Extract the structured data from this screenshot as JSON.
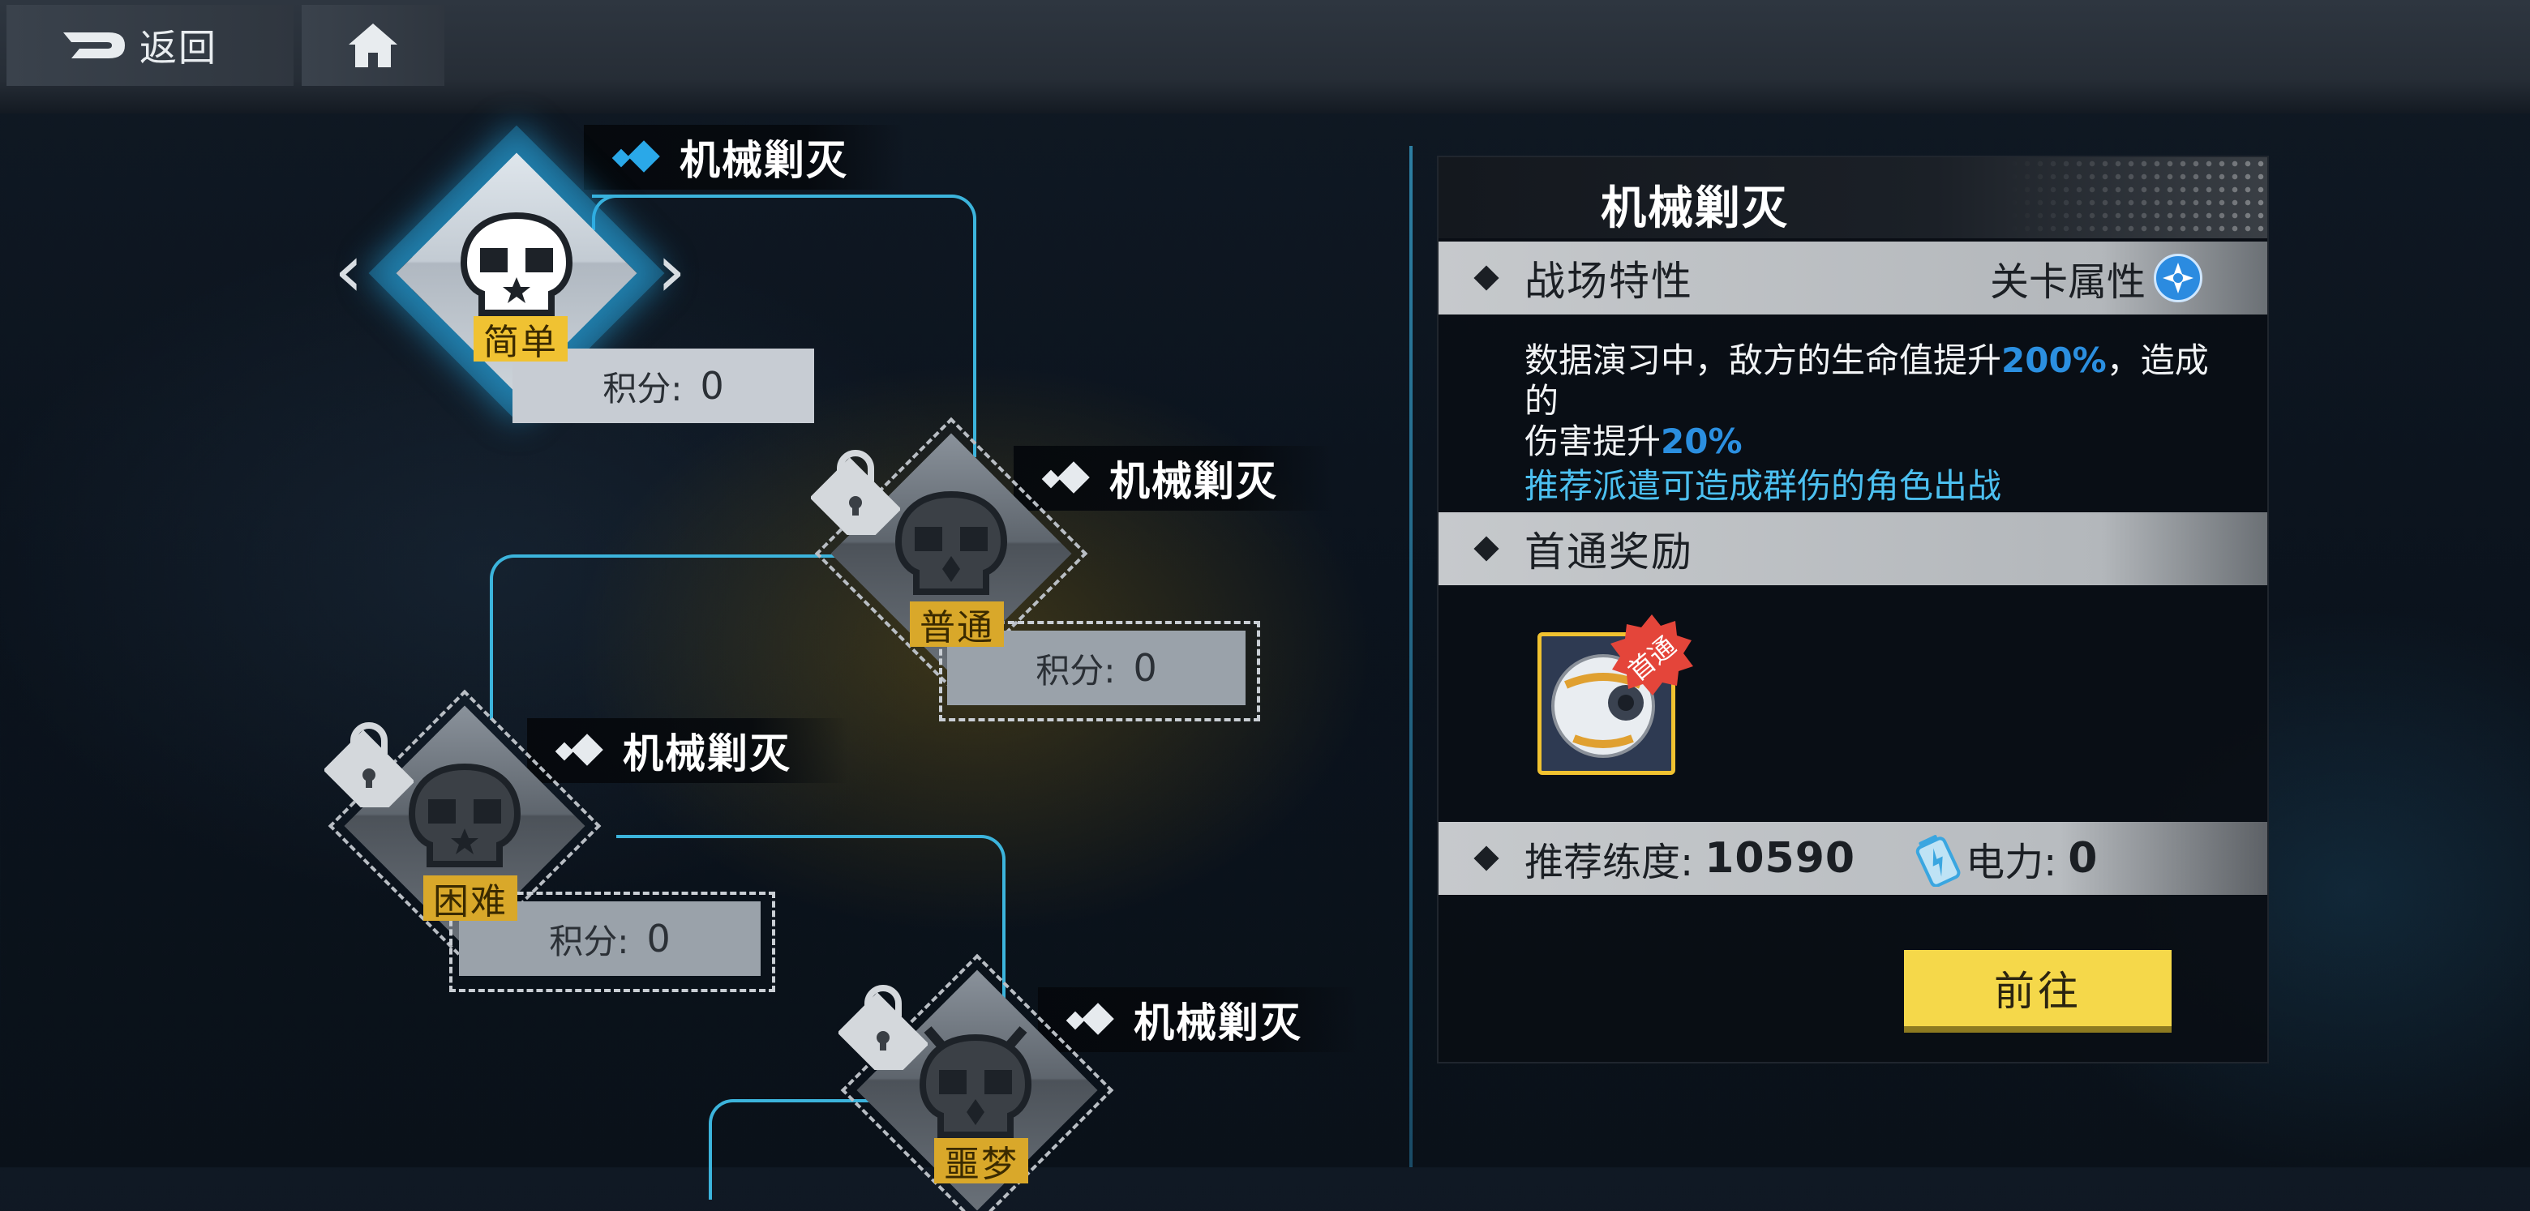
{
  "topbar": {
    "back_label": "返回"
  },
  "stages": [
    {
      "title": "机械剿灭",
      "difficulty": "简单",
      "score_label": "积分:",
      "score": "0"
    },
    {
      "title": "机械剿灭",
      "difficulty": "普通",
      "score_label": "积分:",
      "score": "0"
    },
    {
      "title": "机械剿灭",
      "difficulty": "困难",
      "score_label": "积分:",
      "score": "0"
    },
    {
      "title": "机械剿灭",
      "difficulty": "噩梦"
    }
  ],
  "panel": {
    "title": "机械剿灭",
    "battlefield_label": "战场特性",
    "attribute_label": "关卡属性",
    "desc_1": "数据演习中，敌方的生命值提升",
    "desc_hl_1": "200%",
    "desc_2": "，造成的",
    "desc_3": "伤害提升",
    "desc_hl_2": "20%",
    "recommend": "推荐派遣可造成群伤的角色出战",
    "reward_label": "首通奖励",
    "reward_badge": "首通",
    "level_label": "推荐练度:",
    "level_value": "10590",
    "power_label": "电力:",
    "power_value": "0",
    "go_label": "前往"
  },
  "colors": {
    "accent": "#3cb4dc",
    "highlight": "#2b8fe0",
    "button": "#f5d84a",
    "difficulty": "#d9a82a"
  }
}
